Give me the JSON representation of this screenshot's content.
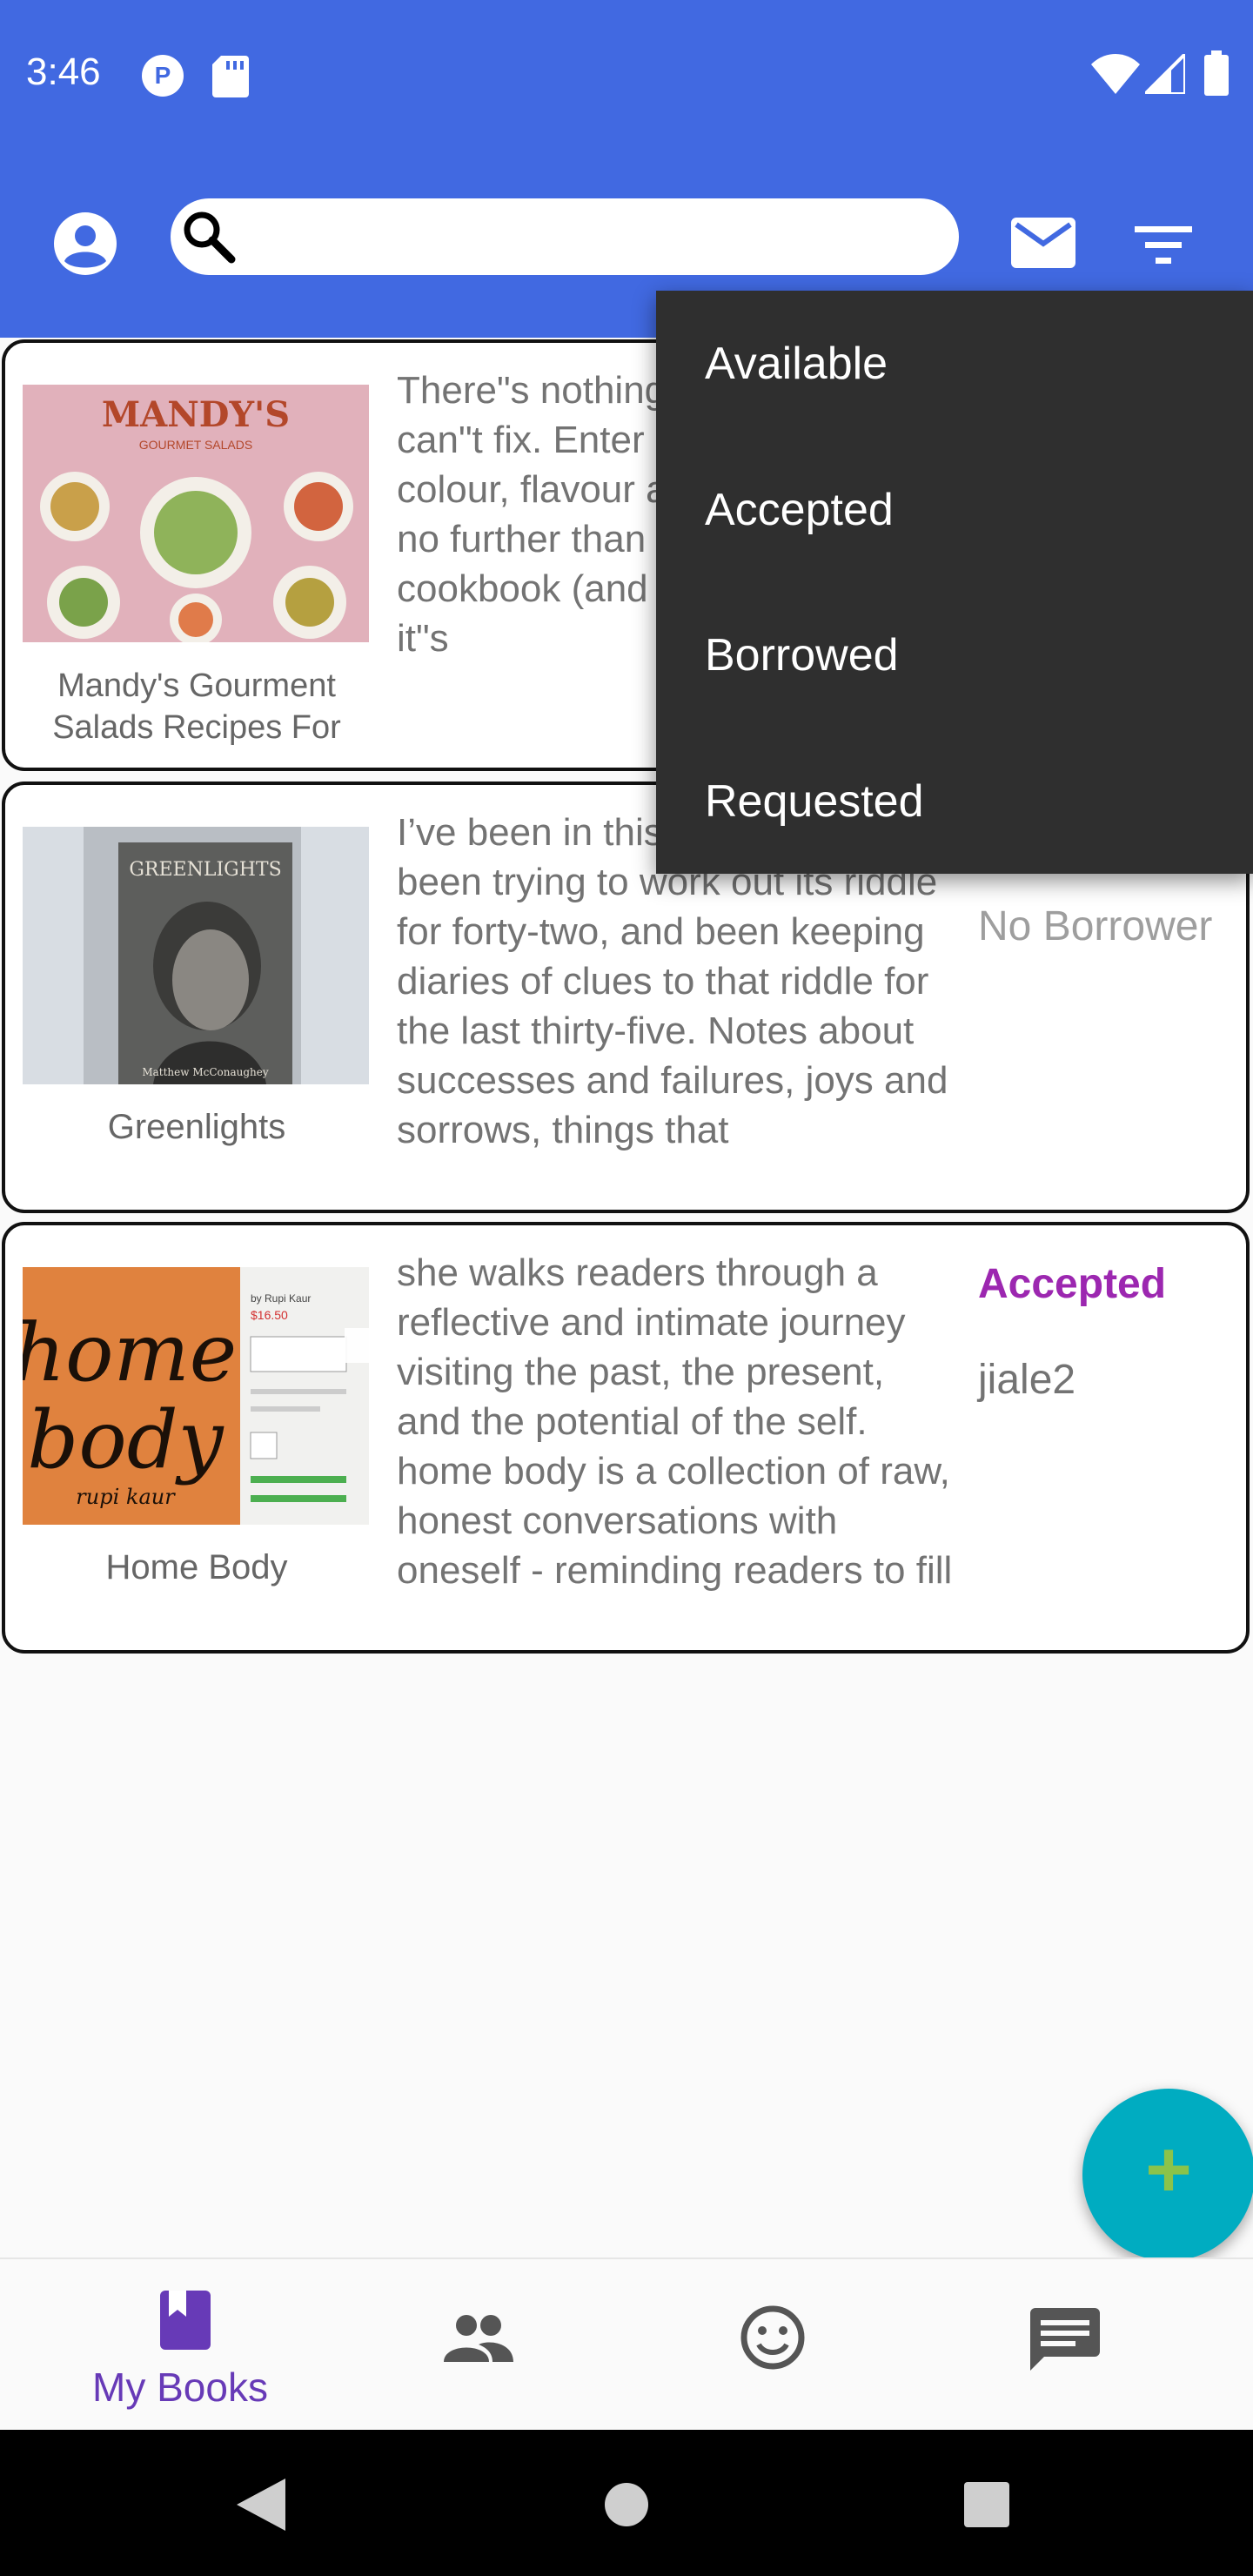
{
  "status_bar": {
    "time": "3:46"
  },
  "app_bar": {
    "search": {
      "value": "",
      "placeholder": ""
    },
    "icons": [
      "account-icon",
      "search-icon",
      "mail-icon",
      "filter-icon"
    ]
  },
  "books": [
    {
      "title": "Mandy's Gourment Salads Recipes For",
      "description": "There\"s nothing a good salad can\"t fix. Enter an explosion of colour, flavour and fantasy. Look no further than the pages of this cookbook (and the restaurants it\"s",
      "status": "",
      "borrower": ""
    },
    {
      "title": "Greenlights",
      "description": "I’ve been in this life fifty years, been trying to work out its riddle for forty-two, and been keeping diaries of clues to that riddle for the last thirty-five. Notes about successes and failures, joys and sorrows, things that",
      "status": "",
      "borrower": "No Borrower"
    },
    {
      "title": "Home Body",
      "description": "she walks readers through a reflective and intimate journey visiting the past, the present, and the potential of the self. home body is a collection of raw, honest conversations with oneself - reminding readers to fill",
      "status": "Accepted",
      "borrower": "jiale2"
    }
  ],
  "filter_menu": {
    "items": [
      "Available",
      "Accepted",
      "Borrowed",
      "Requested"
    ]
  },
  "fab": {
    "label": "+"
  },
  "bottom_nav": {
    "items": [
      {
        "label": "My Books",
        "icon": "book-icon",
        "active": true
      },
      {
        "label": "",
        "icon": "people-icon",
        "active": false
      },
      {
        "label": "",
        "icon": "smiley-icon",
        "active": false
      },
      {
        "label": "",
        "icon": "chat-icon",
        "active": false
      }
    ]
  },
  "colors": {
    "app_bar": "#4169e1",
    "accent": "#9c27b0",
    "fab": "#00acc1",
    "fab_plus": "#8bc34a",
    "nav_active": "#673ab7",
    "menu_bg": "#2f2f2f"
  }
}
